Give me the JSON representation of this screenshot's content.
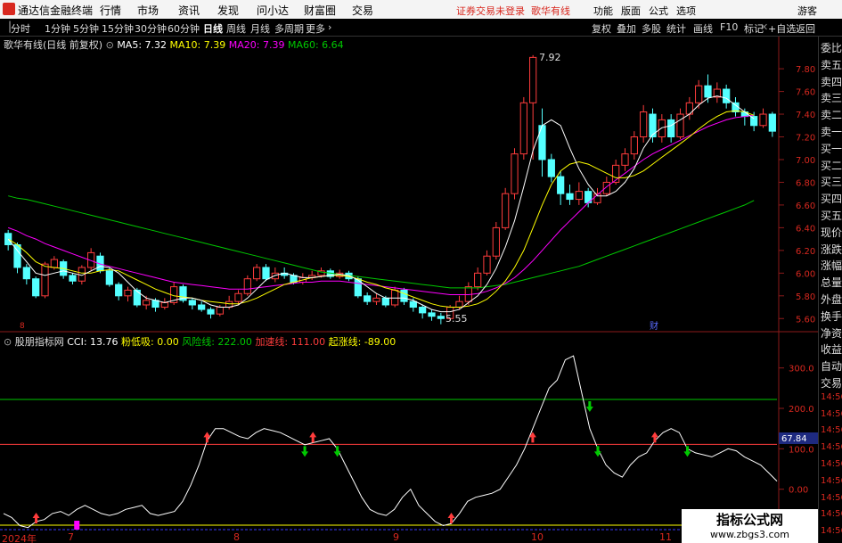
{
  "app": {
    "title": "通达信金融终端",
    "menu": [
      "行情",
      "市场",
      "资讯",
      "发现",
      "问小达",
      "财富圈",
      "交易"
    ],
    "notice": "证券交易未登录",
    "notice2": "歌华有线",
    "controls": [
      "功能",
      "版面",
      "公式",
      "选项"
    ],
    "guest": "游客"
  },
  "toolbar": {
    "periods": [
      "分时",
      "1分钟",
      "5分钟",
      "15分钟",
      "30分钟",
      "60分钟",
      "日线",
      "周线",
      "月线",
      "多周期",
      "更多"
    ],
    "active": "日线",
    "right": [
      "复权",
      "叠加",
      "多股",
      "统计",
      "画线",
      "F10",
      "标记",
      "+自选",
      "返回"
    ]
  },
  "main_legend": {
    "name": "歌华有线(日线 前复权)",
    "ma5": "MA5: 7.32",
    "ma10": "MA10: 7.39",
    "ma20": "MA20: 7.39",
    "ma60": "MA60: 6.64"
  },
  "indicator_legend": {
    "name": "股朋指标网",
    "cci": "CCI: 13.76",
    "l1": "粉低吸: 0.00",
    "l2": "风险线: 222.00",
    "l3": "加速线: 111.00",
    "l4": "起涨线: -89.00"
  },
  "price_axis": [
    "7.80",
    "7.60",
    "7.40",
    "7.20",
    "7.00",
    "6.80",
    "6.60",
    "6.40",
    "6.20",
    "6.00",
    "5.80",
    "5.60"
  ],
  "indicator_axis": [
    "300.0",
    "200.0",
    "100.0",
    "0.00"
  ],
  "cci_box": "67.84",
  "annotations": {
    "high": "7.92",
    "low": "5.55",
    "cai": "财",
    "dividend": "8"
  },
  "sidebar": [
    "委比",
    "卖五",
    "卖四",
    "卖三",
    "卖二",
    "卖一",
    "买一",
    "买二",
    "买三",
    "买四",
    "买五",
    "现价",
    "涨跌",
    "涨幅",
    "总量",
    "外盘",
    "换手",
    "净资",
    "收益",
    "自动",
    "交易",
    "14:56",
    "14:56",
    "14:56",
    "14:56",
    "14:56",
    "14:56",
    "14:56",
    "14:56",
    "14:56"
  ],
  "time_axis": [
    "2024年",
    "7",
    "8",
    "9",
    "10",
    "11"
  ],
  "watermark": {
    "line1": "指标公式网",
    "line2": "www.zbgs3.com"
  },
  "colors": {
    "up": "#ff3c3c",
    "down": "#54ffff",
    "ma5": "#ffffff",
    "ma10": "#ffff00",
    "ma20": "#ff00ff",
    "ma60": "#00c800"
  },
  "chart_data": {
    "type": "candlestick",
    "ylim": [
      5.5,
      7.95
    ],
    "indicator_ylim": [
      -100,
      350
    ],
    "candles": [
      [
        6.35,
        6.25,
        6.38,
        6.2
      ],
      [
        6.25,
        6.05,
        6.27,
        6.0
      ],
      [
        6.05,
        5.95,
        6.08,
        5.9
      ],
      [
        5.95,
        5.8,
        5.97,
        5.78
      ],
      [
        5.8,
        6.08,
        6.1,
        5.78
      ],
      [
        6.05,
        6.12,
        6.15,
        6.03
      ],
      [
        6.1,
        5.98,
        6.12,
        5.95
      ],
      [
        5.98,
        5.93,
        6.0,
        5.9
      ],
      [
        5.93,
        6.05,
        6.07,
        5.9
      ],
      [
        6.05,
        6.18,
        6.22,
        6.02
      ],
      [
        6.15,
        6.02,
        6.18,
        6.0
      ],
      [
        6.02,
        5.9,
        6.05,
        5.88
      ],
      [
        5.9,
        5.8,
        5.92,
        5.76
      ],
      [
        5.8,
        5.85,
        5.88,
        5.75
      ],
      [
        5.85,
        5.72,
        5.87,
        5.7
      ],
      [
        5.72,
        5.76,
        5.8,
        5.68
      ],
      [
        5.76,
        5.7,
        5.78,
        5.66
      ],
      [
        5.7,
        5.74,
        5.78,
        5.68
      ],
      [
        5.74,
        5.88,
        5.92,
        5.72
      ],
      [
        5.88,
        5.76,
        5.9,
        5.74
      ],
      [
        5.76,
        5.72,
        5.78,
        5.68
      ],
      [
        5.72,
        5.68,
        5.75,
        5.66
      ],
      [
        5.68,
        5.64,
        5.7,
        5.6
      ],
      [
        5.64,
        5.7,
        5.72,
        5.62
      ],
      [
        5.7,
        5.75,
        5.8,
        5.68
      ],
      [
        5.75,
        5.82,
        5.85,
        5.72
      ],
      [
        5.82,
        5.95,
        5.98,
        5.8
      ],
      [
        5.95,
        6.05,
        6.08,
        5.93
      ],
      [
        6.05,
        5.95,
        6.08,
        5.93
      ],
      [
        5.95,
        6.0,
        6.05,
        5.92
      ],
      [
        6.0,
        5.98,
        6.05,
        5.95
      ],
      [
        5.98,
        5.92,
        6.0,
        5.9
      ],
      [
        5.92,
        5.96,
        6.0,
        5.9
      ],
      [
        5.96,
        5.98,
        6.02,
        5.94
      ],
      [
        5.98,
        6.02,
        6.05,
        5.96
      ],
      [
        6.02,
        5.97,
        6.04,
        5.95
      ],
      [
        5.97,
        6.0,
        6.03,
        5.95
      ],
      [
        6.0,
        5.95,
        6.02,
        5.93
      ],
      [
        5.95,
        5.8,
        5.97,
        5.78
      ],
      [
        5.8,
        5.75,
        5.83,
        5.72
      ],
      [
        5.75,
        5.78,
        5.82,
        5.72
      ],
      [
        5.78,
        5.72,
        5.8,
        5.7
      ],
      [
        5.72,
        5.85,
        5.88,
        5.7
      ],
      [
        5.85,
        5.75,
        5.87,
        5.72
      ],
      [
        5.75,
        5.7,
        5.78,
        5.66
      ],
      [
        5.7,
        5.65,
        5.72,
        5.6
      ],
      [
        5.65,
        5.62,
        5.68,
        5.58
      ],
      [
        5.62,
        5.6,
        5.65,
        5.55
      ],
      [
        5.6,
        5.7,
        5.72,
        5.58
      ],
      [
        5.7,
        5.75,
        5.8,
        5.68
      ],
      [
        5.75,
        5.88,
        5.92,
        5.72
      ],
      [
        5.88,
        6.0,
        6.05,
        5.85
      ],
      [
        6.0,
        6.15,
        6.2,
        5.98
      ],
      [
        6.15,
        6.4,
        6.45,
        6.12
      ],
      [
        6.4,
        6.7,
        6.75,
        6.38
      ],
      [
        6.7,
        7.05,
        7.1,
        6.65
      ],
      [
        7.05,
        7.5,
        7.55,
        7.0
      ],
      [
        7.5,
        7.9,
        7.92,
        7.0
      ],
      [
        7.3,
        7.0,
        7.45,
        6.85
      ],
      [
        7.0,
        6.85,
        7.05,
        6.8
      ],
      [
        6.85,
        6.7,
        6.9,
        6.6
      ],
      [
        6.7,
        6.65,
        6.78,
        6.6
      ],
      [
        6.65,
        6.72,
        6.8,
        6.6
      ],
      [
        6.72,
        6.62,
        6.75,
        6.58
      ],
      [
        6.62,
        6.7,
        6.75,
        6.6
      ],
      [
        6.7,
        6.8,
        6.85,
        6.68
      ],
      [
        6.8,
        6.95,
        7.0,
        6.78
      ],
      [
        6.95,
        7.05,
        7.1,
        6.9
      ],
      [
        7.05,
        7.2,
        7.25,
        7.0
      ],
      [
        7.2,
        7.42,
        7.48,
        7.15
      ],
      [
        7.4,
        7.2,
        7.45,
        7.15
      ],
      [
        7.2,
        7.35,
        7.4,
        7.15
      ],
      [
        7.35,
        7.2,
        7.4,
        7.15
      ],
      [
        7.2,
        7.4,
        7.45,
        7.18
      ],
      [
        7.4,
        7.5,
        7.55,
        7.35
      ],
      [
        7.5,
        7.65,
        7.7,
        7.45
      ],
      [
        7.65,
        7.55,
        7.75,
        7.5
      ],
      [
        7.55,
        7.62,
        7.68,
        7.5
      ],
      [
        7.62,
        7.5,
        7.66,
        7.45
      ],
      [
        7.5,
        7.42,
        7.55,
        7.38
      ],
      [
        7.42,
        7.38,
        7.45,
        7.3
      ],
      [
        7.38,
        7.3,
        7.42,
        7.25
      ],
      [
        7.3,
        7.4,
        7.45,
        7.28
      ],
      [
        7.4,
        7.25,
        7.42,
        7.2
      ]
    ],
    "ma5": [
      6.3,
      6.2,
      6.1,
      6.0,
      5.98,
      6.0,
      6.02,
      6.0,
      5.98,
      6.02,
      6.06,
      6.05,
      6.0,
      5.92,
      5.84,
      5.78,
      5.76,
      5.74,
      5.76,
      5.78,
      5.78,
      5.76,
      5.72,
      5.7,
      5.7,
      5.72,
      5.78,
      5.86,
      5.94,
      5.98,
      6.0,
      5.98,
      5.96,
      5.96,
      5.97,
      5.98,
      5.99,
      5.98,
      5.94,
      5.88,
      5.82,
      5.78,
      5.78,
      5.78,
      5.76,
      5.72,
      5.68,
      5.66,
      5.66,
      5.68,
      5.74,
      5.8,
      5.9,
      6.04,
      6.23,
      6.46,
      6.76,
      7.08,
      7.3,
      7.35,
      7.3,
      7.1,
      6.92,
      6.78,
      6.68,
      6.68,
      6.72,
      6.8,
      6.92,
      7.1,
      7.22,
      7.28,
      7.3,
      7.35,
      7.4,
      7.48,
      7.54,
      7.56,
      7.54,
      7.48,
      7.42,
      7.36
    ],
    "ma10": [
      6.3,
      6.25,
      6.18,
      6.1,
      6.06,
      6.05,
      6.04,
      6.02,
      6.0,
      6.0,
      6.02,
      6.03,
      6.02,
      5.98,
      5.94,
      5.9,
      5.86,
      5.83,
      5.8,
      5.79,
      5.78,
      5.76,
      5.75,
      5.74,
      5.73,
      5.73,
      5.75,
      5.78,
      5.82,
      5.86,
      5.9,
      5.92,
      5.94,
      5.96,
      5.97,
      5.98,
      5.98,
      5.97,
      5.95,
      5.92,
      5.9,
      5.87,
      5.85,
      5.82,
      5.79,
      5.76,
      5.73,
      5.71,
      5.7,
      5.7,
      5.71,
      5.73,
      5.77,
      5.84,
      5.93,
      6.05,
      6.2,
      6.4,
      6.6,
      6.78,
      6.9,
      6.96,
      6.98,
      6.96,
      6.92,
      6.88,
      6.84,
      6.84,
      6.86,
      6.9,
      6.96,
      7.02,
      7.08,
      7.14,
      7.2,
      7.27,
      7.33,
      7.38,
      7.42,
      7.43,
      7.42,
      7.39
    ],
    "ma20": [
      6.4,
      6.37,
      6.33,
      6.3,
      6.26,
      6.23,
      6.2,
      6.17,
      6.14,
      6.11,
      6.08,
      6.06,
      6.04,
      6.02,
      6.0,
      5.98,
      5.96,
      5.94,
      5.92,
      5.91,
      5.9,
      5.89,
      5.88,
      5.87,
      5.86,
      5.86,
      5.86,
      5.87,
      5.88,
      5.89,
      5.9,
      5.91,
      5.92,
      5.92,
      5.93,
      5.93,
      5.93,
      5.92,
      5.91,
      5.9,
      5.89,
      5.88,
      5.87,
      5.86,
      5.85,
      5.84,
      5.83,
      5.82,
      5.81,
      5.81,
      5.81,
      5.82,
      5.84,
      5.87,
      5.91,
      5.96,
      6.03,
      6.11,
      6.2,
      6.29,
      6.38,
      6.46,
      6.54,
      6.62,
      6.69,
      6.76,
      6.82,
      6.88,
      6.94,
      7.0,
      7.05,
      7.09,
      7.13,
      7.17,
      7.21,
      7.25,
      7.29,
      7.32,
      7.35,
      7.37,
      7.38,
      7.39
    ],
    "ma60": [
      6.68,
      6.66,
      6.65,
      6.63,
      6.61,
      6.59,
      6.57,
      6.55,
      6.53,
      6.51,
      6.49,
      6.47,
      6.45,
      6.43,
      6.41,
      6.39,
      6.37,
      6.35,
      6.33,
      6.31,
      6.29,
      6.27,
      6.25,
      6.23,
      6.21,
      6.19,
      6.17,
      6.15,
      6.13,
      6.11,
      6.09,
      6.07,
      6.05,
      6.03,
      6.01,
      6.0,
      5.99,
      5.98,
      5.97,
      5.96,
      5.95,
      5.94,
      5.93,
      5.92,
      5.91,
      5.9,
      5.89,
      5.88,
      5.87,
      5.87,
      5.87,
      5.87,
      5.88,
      5.89,
      5.9,
      5.92,
      5.94,
      5.96,
      5.98,
      6.0,
      6.02,
      6.04,
      6.06,
      6.09,
      6.12,
      6.15,
      6.18,
      6.21,
      6.24,
      6.27,
      6.3,
      6.33,
      6.36,
      6.39,
      6.42,
      6.45,
      6.48,
      6.51,
      6.54,
      6.57,
      6.6,
      6.64
    ],
    "cci": [
      -60,
      -70,
      -90,
      -95,
      -80,
      -75,
      -60,
      -55,
      -65,
      -50,
      -40,
      -50,
      -60,
      -65,
      -60,
      -50,
      -45,
      -40,
      -60,
      -65,
      -60,
      -55,
      -30,
      10,
      60,
      120,
      150,
      150,
      140,
      130,
      125,
      140,
      150,
      145,
      140,
      130,
      120,
      110,
      115,
      120,
      125,
      100,
      60,
      20,
      -20,
      -50,
      -60,
      -65,
      -50,
      -20,
      0,
      -40,
      -60,
      -80,
      -90,
      -85,
      -60,
      -30,
      -20,
      -15,
      -10,
      0,
      30,
      60,
      100,
      150,
      200,
      250,
      270,
      320,
      330,
      240,
      150,
      100,
      60,
      40,
      30,
      60,
      80,
      90,
      120,
      140,
      150,
      140,
      100,
      90,
      85,
      80,
      90,
      100,
      95,
      80,
      70,
      60,
      40,
      20
    ],
    "cci_x_count": 96,
    "risk_line": 222,
    "accel_line": 111,
    "rise_line": -89
  }
}
